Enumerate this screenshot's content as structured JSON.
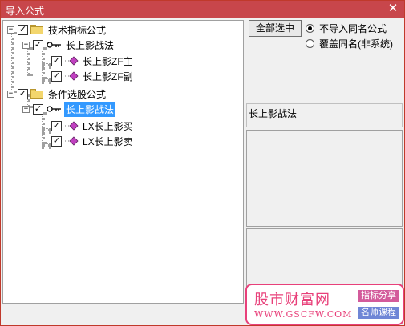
{
  "window": {
    "title": "导入公式",
    "close_glyph": "✕"
  },
  "tree": {
    "expand_glyph": "−",
    "check_glyph": "✓",
    "nodes": [
      {
        "label": "技术指标公式",
        "checked": true,
        "kind": "folder"
      },
      {
        "label": "长上影战法",
        "checked": true,
        "kind": "key"
      },
      {
        "label": "长上影ZF主",
        "checked": true,
        "kind": "formula"
      },
      {
        "label": "长上影ZF副",
        "checked": true,
        "kind": "formula"
      },
      {
        "label": "条件选股公式",
        "checked": true,
        "kind": "folder"
      },
      {
        "label": "长上影战法",
        "checked": true,
        "kind": "key",
        "selected": true
      },
      {
        "label": "LX长上影买",
        "checked": true,
        "kind": "formula"
      },
      {
        "label": "LX长上影卖",
        "checked": true,
        "kind": "formula"
      }
    ]
  },
  "buttons": {
    "select_all": "全部选中"
  },
  "options": {
    "no_import": {
      "label": "不导入同名公式",
      "selected": true
    },
    "overwrite": {
      "label": "覆盖同名(非系统)",
      "selected": false
    }
  },
  "info": {
    "text": "长上影战法"
  },
  "watermark": {
    "brand": "股市财富网",
    "url": "WWW.GSCFW.COM",
    "tag1": "指标分享",
    "tag2": "名师课程"
  },
  "colors": {
    "titlebar": "#c8464b",
    "selection": "#3399ff",
    "watermark": "#e8407a"
  }
}
